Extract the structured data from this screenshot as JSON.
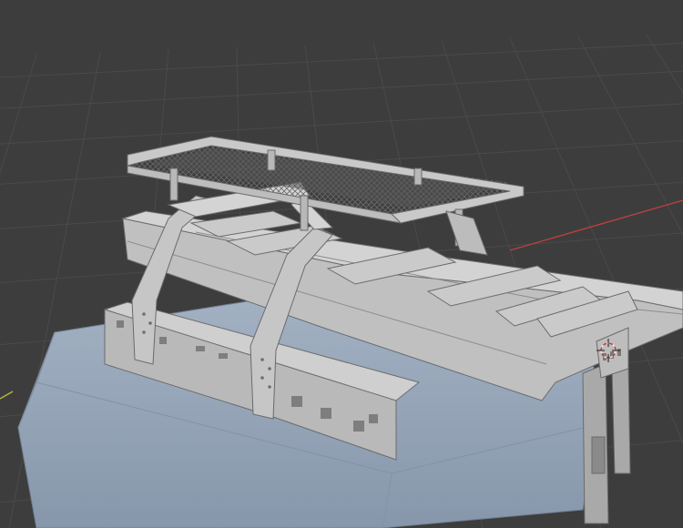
{
  "viewport": {
    "background": "#3d3d3d",
    "grid_color": "#4a4a4a",
    "x_axis_color": "#b8413f",
    "y_axis_color": "#b7b84a",
    "cursor_icon": "3d-cursor-icon"
  },
  "model": {
    "body_color": "#93a3b6",
    "rack_color": "#c3c3c3",
    "mesh_color": "#5a5a5a"
  }
}
